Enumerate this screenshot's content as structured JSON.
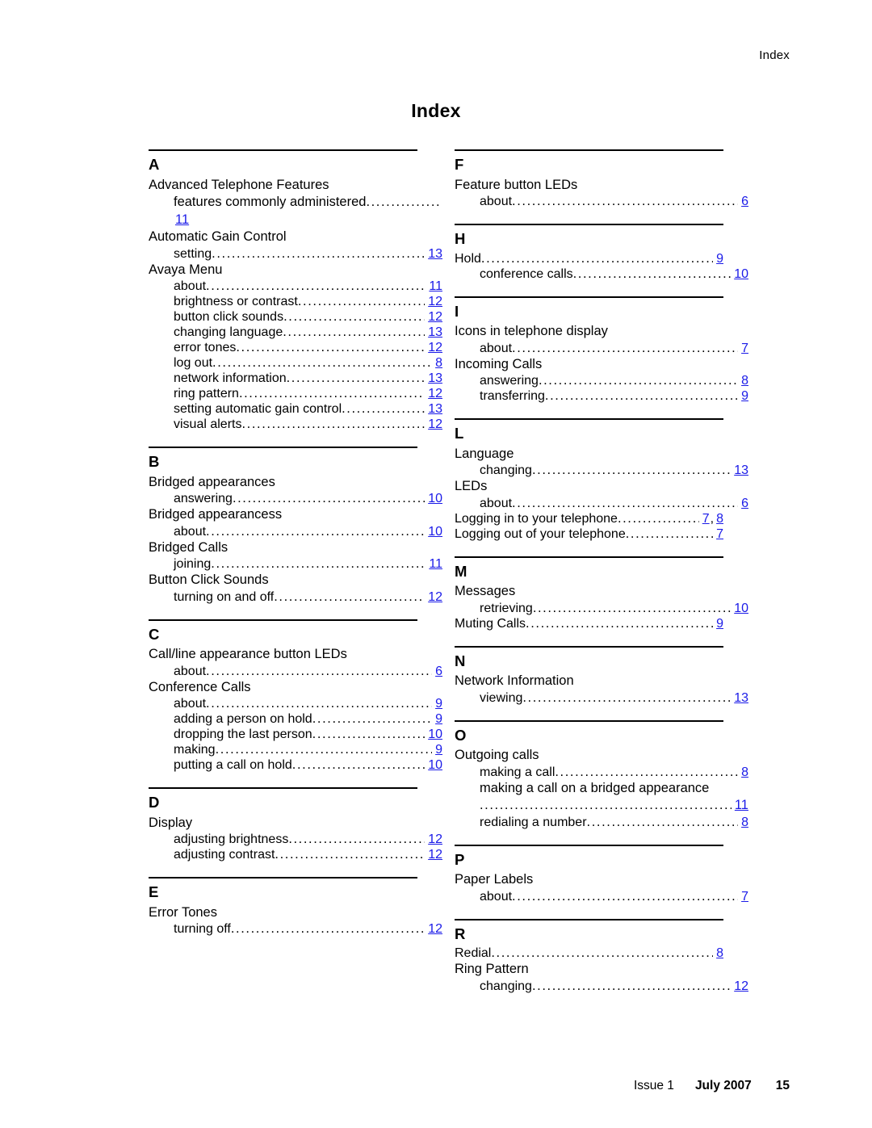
{
  "header": {
    "running_title": "Index"
  },
  "title": "Index",
  "footer": {
    "issue": "Issue 1",
    "date": "July 2007",
    "page_number": "15"
  },
  "accent_color": "#1a1ae8",
  "columns": [
    {
      "groups": [
        {
          "letter": "A",
          "entries": [
            {
              "type": "main",
              "text": "Advanced Telephone Features"
            },
            {
              "type": "sub-wrapped",
              "text": "features commonly administered",
              "page": "11"
            },
            {
              "type": "main",
              "text": "Automatic Gain Control"
            },
            {
              "type": "sub",
              "text": "setting",
              "page": "13"
            },
            {
              "type": "main",
              "text": "Avaya Menu"
            },
            {
              "type": "sub",
              "text": "about",
              "page": "11"
            },
            {
              "type": "sub",
              "text": "brightness or contrast",
              "page": "12"
            },
            {
              "type": "sub",
              "text": "button click sounds",
              "page": "12"
            },
            {
              "type": "sub",
              "text": "changing language",
              "page": "13"
            },
            {
              "type": "sub",
              "text": "error tones",
              "page": "12"
            },
            {
              "type": "sub",
              "text": "log out",
              "page": "8"
            },
            {
              "type": "sub",
              "text": "network information",
              "page": "13"
            },
            {
              "type": "sub",
              "text": "ring pattern",
              "page": "12"
            },
            {
              "type": "sub",
              "text": "setting automatic gain control",
              "page": "13"
            },
            {
              "type": "sub",
              "text": "visual alerts",
              "page": "12"
            }
          ]
        },
        {
          "letter": "B",
          "entries": [
            {
              "type": "main",
              "text": "Bridged appearances"
            },
            {
              "type": "sub",
              "text": "answering",
              "page": "10"
            },
            {
              "type": "main",
              "text": "Bridged appearancess"
            },
            {
              "type": "sub",
              "text": "about",
              "page": "10"
            },
            {
              "type": "main",
              "text": "Bridged Calls"
            },
            {
              "type": "sub",
              "text": "joining",
              "page": "11"
            },
            {
              "type": "main",
              "text": "Button Click Sounds"
            },
            {
              "type": "sub",
              "text": "turning on and off",
              "page": "12"
            }
          ]
        },
        {
          "letter": "C",
          "entries": [
            {
              "type": "main",
              "text": "Call/line appearance button LEDs"
            },
            {
              "type": "sub",
              "text": "about",
              "page": "6"
            },
            {
              "type": "main",
              "text": "Conference Calls"
            },
            {
              "type": "sub",
              "text": "about",
              "page": "9"
            },
            {
              "type": "sub",
              "text": "adding a person on hold",
              "page": "9"
            },
            {
              "type": "sub",
              "text": "dropping the last person",
              "page": "10"
            },
            {
              "type": "sub",
              "text": "making",
              "page": "9"
            },
            {
              "type": "sub",
              "text": "putting a call on hold",
              "page": "10"
            }
          ]
        },
        {
          "letter": "D",
          "entries": [
            {
              "type": "main",
              "text": "Display"
            },
            {
              "type": "sub",
              "text": "adjusting brightness",
              "page": "12"
            },
            {
              "type": "sub",
              "text": "adjusting contrast",
              "page": "12"
            }
          ]
        },
        {
          "letter": "E",
          "entries": [
            {
              "type": "main",
              "text": "Error Tones"
            },
            {
              "type": "sub",
              "text": "turning off",
              "page": "12"
            }
          ]
        }
      ]
    },
    {
      "groups": [
        {
          "letter": "F",
          "entries": [
            {
              "type": "main",
              "text": "Feature button LEDs"
            },
            {
              "type": "sub",
              "text": "about",
              "page": "6"
            }
          ]
        },
        {
          "letter": "H",
          "entries": [
            {
              "type": "main-leader",
              "text": "Hold",
              "page": "9"
            },
            {
              "type": "sub",
              "text": "conference calls",
              "page": "10"
            }
          ]
        },
        {
          "letter": "I",
          "entries": [
            {
              "type": "main",
              "text": "Icons in telephone display"
            },
            {
              "type": "sub",
              "text": "about",
              "page": "7"
            },
            {
              "type": "main",
              "text": "Incoming Calls"
            },
            {
              "type": "sub",
              "text": "answering",
              "page": "8"
            },
            {
              "type": "sub",
              "text": "transferring",
              "page": "9"
            }
          ]
        },
        {
          "letter": "L",
          "entries": [
            {
              "type": "main",
              "text": "Language"
            },
            {
              "type": "sub",
              "text": "changing",
              "page": "13"
            },
            {
              "type": "main",
              "text": "LEDs"
            },
            {
              "type": "sub",
              "text": "about",
              "page": "6"
            },
            {
              "type": "main-leader-multi",
              "text": "Logging in to your telephone",
              "pages": [
                "7",
                "8"
              ],
              "separator": ","
            },
            {
              "type": "main-leader",
              "text": "Logging out of your telephone",
              "page": "7"
            }
          ]
        },
        {
          "letter": "M",
          "entries": [
            {
              "type": "main",
              "text": "Messages"
            },
            {
              "type": "sub",
              "text": "retrieving",
              "page": "10"
            },
            {
              "type": "main-leader",
              "text": "Muting Calls",
              "page": "9"
            }
          ]
        },
        {
          "letter": "N",
          "entries": [
            {
              "type": "main",
              "text": "Network Information"
            },
            {
              "type": "sub",
              "text": "viewing",
              "page": "13"
            }
          ]
        },
        {
          "letter": "O",
          "entries": [
            {
              "type": "main",
              "text": "Outgoing calls"
            },
            {
              "type": "sub",
              "text": "making a call",
              "page": "8"
            },
            {
              "type": "sub-wrapped-dots",
              "text": "making a call on a bridged appearance",
              "page": "11"
            },
            {
              "type": "sub",
              "text": "redialing a number",
              "page": "8"
            }
          ]
        },
        {
          "letter": "P",
          "entries": [
            {
              "type": "main",
              "text": "Paper Labels"
            },
            {
              "type": "sub",
              "text": "about",
              "page": "7"
            }
          ]
        },
        {
          "letter": "R",
          "entries": [
            {
              "type": "main-leader",
              "text": "Redial",
              "page": "8"
            },
            {
              "type": "main",
              "text": "Ring Pattern"
            },
            {
              "type": "sub",
              "text": "changing",
              "page": "12"
            }
          ]
        }
      ]
    }
  ]
}
